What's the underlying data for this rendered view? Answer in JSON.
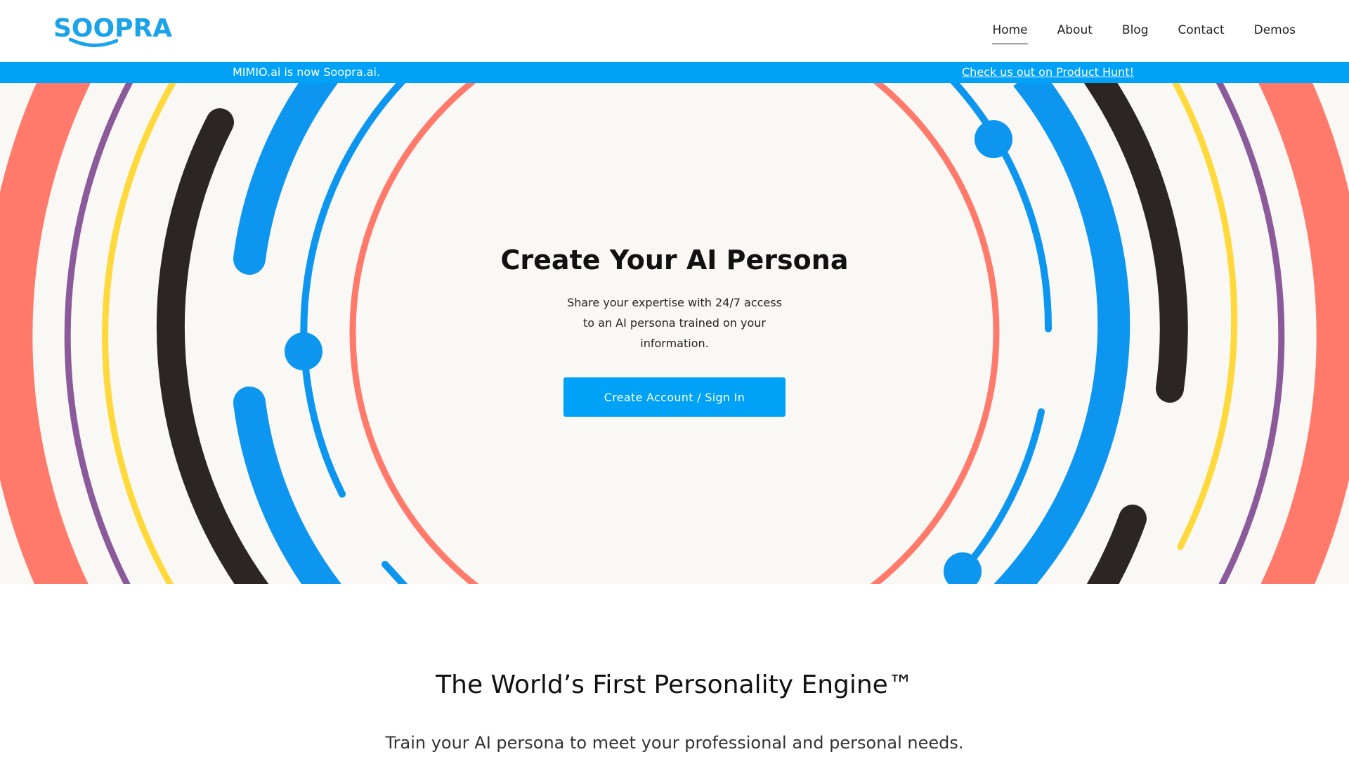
{
  "header": {
    "logo_text": "SOOPRA",
    "nav": [
      {
        "label": "Home",
        "active": true
      },
      {
        "label": "About"
      },
      {
        "label": "Blog"
      },
      {
        "label": "Contact"
      },
      {
        "label": "Demos"
      }
    ]
  },
  "banner": {
    "left_text": "MIMIO.ai is now Soopra.ai.",
    "right_link": "Check us out on Product Hunt!"
  },
  "hero": {
    "title": "Create Your AI Persona",
    "subtitle": "Share your expertise with 24/7 access to an AI persona trained on your information.",
    "cta_label": "Create Account / Sign In"
  },
  "section": {
    "title": "The World’s First Personality Engine™",
    "subtitle": "Train your AI persona to meet your professional and personal needs."
  },
  "colors": {
    "brand_blue": "#00a2f7",
    "logo_blue": "#1aa3ea",
    "coral": "#ff7a6b",
    "purple": "#8b5a9b",
    "yellow": "#ffd93b",
    "black": "#2b2624",
    "hero_bg": "#faf8f5"
  }
}
